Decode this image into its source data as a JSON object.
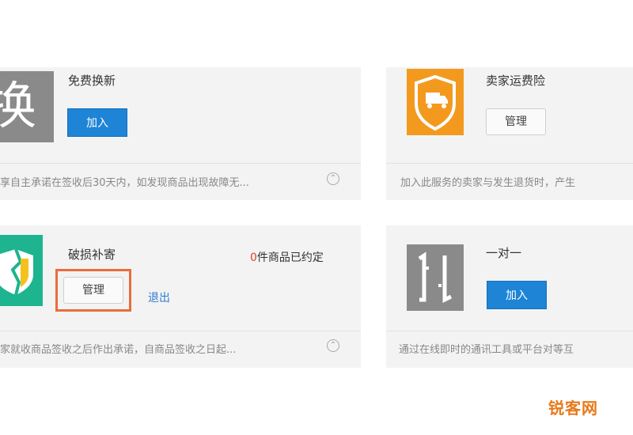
{
  "cards": [
    {
      "title": "免费换新",
      "icon_name": "swap-char-icon",
      "icon_glyph": "换",
      "button_label": "加入",
      "description": "享自主承诺在签收后30天内，如发现商品出现故障无...",
      "expand_icon": "expand-circle-icon"
    },
    {
      "title": "卖家运费险",
      "icon_name": "truck-shield-icon",
      "button_label": "管理",
      "description": "加入此服务的卖家与发生退货时，产生"
    },
    {
      "title": "破损补寄",
      "icon_name": "broken-shield-icon",
      "status_count": "0",
      "status_text": "件商品已约定",
      "button_label": "管理",
      "link_label": "退出",
      "description": "家就收商品签收之后作出承诺，自商品签收之日起...",
      "expand_icon": "expand-circle-icon"
    },
    {
      "title": "一对一",
      "icon_name": "one-to-one-icon",
      "button_label": "加入",
      "description": "通过在线即时的通讯工具或平台对等互"
    }
  ],
  "watermark": "锐客网",
  "colors": {
    "button_blue": "#1e84d6",
    "highlight_orange": "#ea6c3d",
    "status_red": "#e53d2b",
    "icon_gray": "#8a8a8a",
    "icon_orange": "#f39a1e",
    "icon_teal": "#1db48f"
  }
}
